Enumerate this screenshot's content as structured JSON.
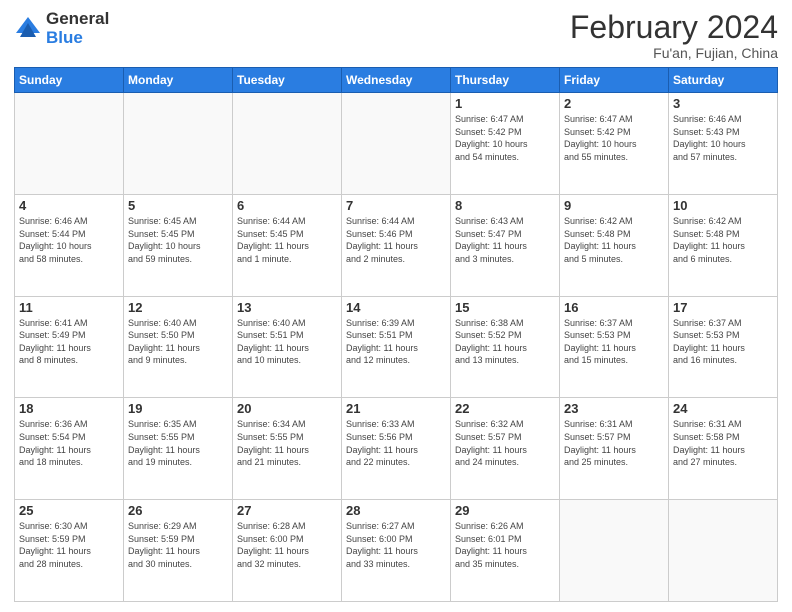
{
  "header": {
    "logo_general": "General",
    "logo_blue": "Blue",
    "title": "February 2024",
    "location": "Fu'an, Fujian, China"
  },
  "days_of_week": [
    "Sunday",
    "Monday",
    "Tuesday",
    "Wednesday",
    "Thursday",
    "Friday",
    "Saturday"
  ],
  "weeks": [
    [
      {
        "day": "",
        "info": ""
      },
      {
        "day": "",
        "info": ""
      },
      {
        "day": "",
        "info": ""
      },
      {
        "day": "",
        "info": ""
      },
      {
        "day": "1",
        "info": "Sunrise: 6:47 AM\nSunset: 5:42 PM\nDaylight: 10 hours\nand 54 minutes."
      },
      {
        "day": "2",
        "info": "Sunrise: 6:47 AM\nSunset: 5:42 PM\nDaylight: 10 hours\nand 55 minutes."
      },
      {
        "day": "3",
        "info": "Sunrise: 6:46 AM\nSunset: 5:43 PM\nDaylight: 10 hours\nand 57 minutes."
      }
    ],
    [
      {
        "day": "4",
        "info": "Sunrise: 6:46 AM\nSunset: 5:44 PM\nDaylight: 10 hours\nand 58 minutes."
      },
      {
        "day": "5",
        "info": "Sunrise: 6:45 AM\nSunset: 5:45 PM\nDaylight: 10 hours\nand 59 minutes."
      },
      {
        "day": "6",
        "info": "Sunrise: 6:44 AM\nSunset: 5:45 PM\nDaylight: 11 hours\nand 1 minute."
      },
      {
        "day": "7",
        "info": "Sunrise: 6:44 AM\nSunset: 5:46 PM\nDaylight: 11 hours\nand 2 minutes."
      },
      {
        "day": "8",
        "info": "Sunrise: 6:43 AM\nSunset: 5:47 PM\nDaylight: 11 hours\nand 3 minutes."
      },
      {
        "day": "9",
        "info": "Sunrise: 6:42 AM\nSunset: 5:48 PM\nDaylight: 11 hours\nand 5 minutes."
      },
      {
        "day": "10",
        "info": "Sunrise: 6:42 AM\nSunset: 5:48 PM\nDaylight: 11 hours\nand 6 minutes."
      }
    ],
    [
      {
        "day": "11",
        "info": "Sunrise: 6:41 AM\nSunset: 5:49 PM\nDaylight: 11 hours\nand 8 minutes."
      },
      {
        "day": "12",
        "info": "Sunrise: 6:40 AM\nSunset: 5:50 PM\nDaylight: 11 hours\nand 9 minutes."
      },
      {
        "day": "13",
        "info": "Sunrise: 6:40 AM\nSunset: 5:51 PM\nDaylight: 11 hours\nand 10 minutes."
      },
      {
        "day": "14",
        "info": "Sunrise: 6:39 AM\nSunset: 5:51 PM\nDaylight: 11 hours\nand 12 minutes."
      },
      {
        "day": "15",
        "info": "Sunrise: 6:38 AM\nSunset: 5:52 PM\nDaylight: 11 hours\nand 13 minutes."
      },
      {
        "day": "16",
        "info": "Sunrise: 6:37 AM\nSunset: 5:53 PM\nDaylight: 11 hours\nand 15 minutes."
      },
      {
        "day": "17",
        "info": "Sunrise: 6:37 AM\nSunset: 5:53 PM\nDaylight: 11 hours\nand 16 minutes."
      }
    ],
    [
      {
        "day": "18",
        "info": "Sunrise: 6:36 AM\nSunset: 5:54 PM\nDaylight: 11 hours\nand 18 minutes."
      },
      {
        "day": "19",
        "info": "Sunrise: 6:35 AM\nSunset: 5:55 PM\nDaylight: 11 hours\nand 19 minutes."
      },
      {
        "day": "20",
        "info": "Sunrise: 6:34 AM\nSunset: 5:55 PM\nDaylight: 11 hours\nand 21 minutes."
      },
      {
        "day": "21",
        "info": "Sunrise: 6:33 AM\nSunset: 5:56 PM\nDaylight: 11 hours\nand 22 minutes."
      },
      {
        "day": "22",
        "info": "Sunrise: 6:32 AM\nSunset: 5:57 PM\nDaylight: 11 hours\nand 24 minutes."
      },
      {
        "day": "23",
        "info": "Sunrise: 6:31 AM\nSunset: 5:57 PM\nDaylight: 11 hours\nand 25 minutes."
      },
      {
        "day": "24",
        "info": "Sunrise: 6:31 AM\nSunset: 5:58 PM\nDaylight: 11 hours\nand 27 minutes."
      }
    ],
    [
      {
        "day": "25",
        "info": "Sunrise: 6:30 AM\nSunset: 5:59 PM\nDaylight: 11 hours\nand 28 minutes."
      },
      {
        "day": "26",
        "info": "Sunrise: 6:29 AM\nSunset: 5:59 PM\nDaylight: 11 hours\nand 30 minutes."
      },
      {
        "day": "27",
        "info": "Sunrise: 6:28 AM\nSunset: 6:00 PM\nDaylight: 11 hours\nand 32 minutes."
      },
      {
        "day": "28",
        "info": "Sunrise: 6:27 AM\nSunset: 6:00 PM\nDaylight: 11 hours\nand 33 minutes."
      },
      {
        "day": "29",
        "info": "Sunrise: 6:26 AM\nSunset: 6:01 PM\nDaylight: 11 hours\nand 35 minutes."
      },
      {
        "day": "",
        "info": ""
      },
      {
        "day": "",
        "info": ""
      }
    ]
  ]
}
